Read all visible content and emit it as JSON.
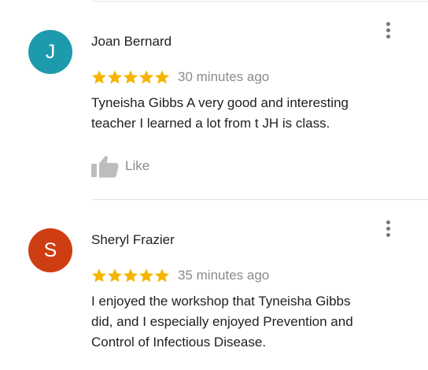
{
  "reviews": [
    {
      "avatar_letter": "J",
      "avatar_color": "#1d9bad",
      "author": "Joan Bernard",
      "rating": 5,
      "time": "30 minutes ago",
      "text_lines": [
        "Tyneisha Gibbs  A very good and interesting",
        "teacher I learned a lot from t JH is class."
      ],
      "like_label": "Like",
      "more_icon": "more-vert-icon"
    },
    {
      "avatar_letter": "S",
      "avatar_color": "#cf3e12",
      "author": "Sheryl Frazier",
      "rating": 5,
      "time": "35 minutes ago",
      "text_lines": [
        "I enjoyed the workshop that Tyneisha Gibbs",
        "did, and I especially enjoyed Prevention and",
        "Control of Infectious Disease."
      ],
      "more_icon": "more-vert-icon"
    }
  ],
  "colors": {
    "star": "#f6b400",
    "muted_text": "#8a8a8a",
    "icon_gray": "#bdbdbd",
    "divider": "#e3e3e3"
  }
}
